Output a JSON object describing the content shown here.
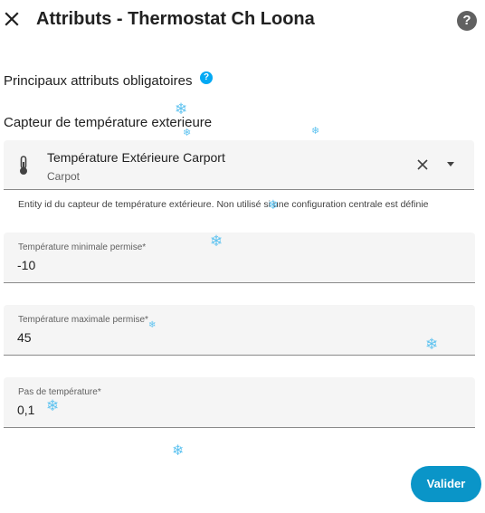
{
  "dialog": {
    "title": "Attributs - Thermostat Ch Loona",
    "close_icon": "close-icon",
    "help_icon": "help-circle-icon",
    "help_glyph": "?"
  },
  "section": {
    "heading": "Principaux attributs obligatoires",
    "info_glyph": "?"
  },
  "outdoor_sensor": {
    "label": "Capteur de température exterieure",
    "entity_name": "Température Extérieure Carport",
    "entity_area": "Carpot",
    "entity_icon": "thermometer-icon",
    "helper": "Entity id du capteur de température extérieure. Non utilisé si une configuration centrale est définie"
  },
  "fields": [
    {
      "label": "Température minimale permise*",
      "value": "-10"
    },
    {
      "label": "Température maximale permise*",
      "value": "45"
    },
    {
      "label": "Pas de température*",
      "value": "0,1"
    }
  ],
  "actions": {
    "submit_label": "Valider"
  },
  "decoration": {
    "snowflake_glyph": "❄",
    "color": "#5fc3f0"
  },
  "colors": {
    "primary": "#0a95c8",
    "info": "#03a9f4",
    "field_bg": "#f5f5f5"
  }
}
